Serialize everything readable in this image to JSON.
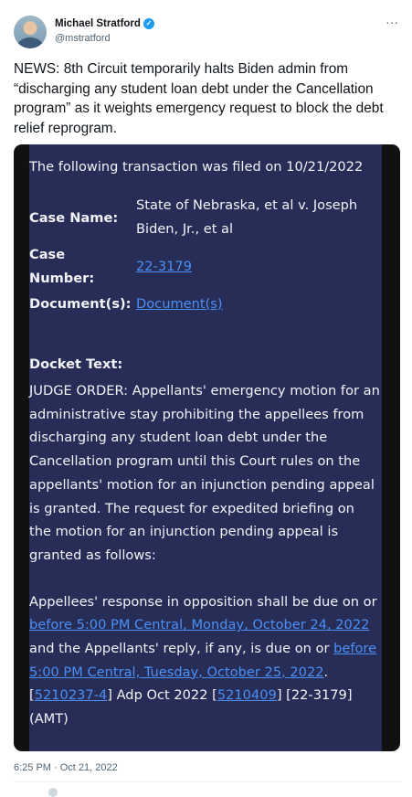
{
  "author": {
    "name": "Michael Stratford",
    "handle": "@mstratford",
    "more_icon": "more-horizontal-icon"
  },
  "tweet": {
    "text": "NEWS: 8th Circuit temporarily halts Biden admin from “discharging any student loan debt under the Cancellation program” as it weights emergency request to block the debt relief reprogram.",
    "timestamp": "6:25 PM · Oct 21, 2022"
  },
  "document": {
    "filed_line": "The following transaction was filed on 10/21/2022",
    "case_name_label": "Case Name:",
    "case_name_line1": "State of Nebraska, et al v. Joseph",
    "case_name_line2": "Biden, Jr., et al",
    "case_number_label_1": "Case",
    "case_number_label_2": "Number:",
    "case_number": "22-3179",
    "documents_label": "Document(s):",
    "documents_link": "Document(s)",
    "docket_label": "Docket Text:",
    "docket_text": "JUDGE ORDER: Appellants' emergency motion for an administrative stay prohibiting the appellees from discharging any student loan debt under the Cancellation program until this Court rules on the appellants' motion for an injunction pending appeal is granted. The request for expedited briefing on the motion for an injunction pending appeal is granted as follows:",
    "p2_part1": "Appellees' response in opposition shall be due on or ",
    "p2_link1": "before 5:00 PM Central, Monday, October 24, 2022",
    "p2_part2": " and the Appellants' reply, if any, is due on or ",
    "p2_link2": "before 5:00 PM Central, Tuesday, October 25, 2022",
    "p2_part3": ". [",
    "p2_link3": "5210237-4",
    "p2_part4": "] Adp Oct 2022 [",
    "p2_link4": "5210409",
    "p2_part5": "] [22-3179] (AMT)"
  },
  "colors": {
    "doc_background": "#272d56",
    "link": "#4b90f5",
    "verified": "#1d9bf0"
  }
}
